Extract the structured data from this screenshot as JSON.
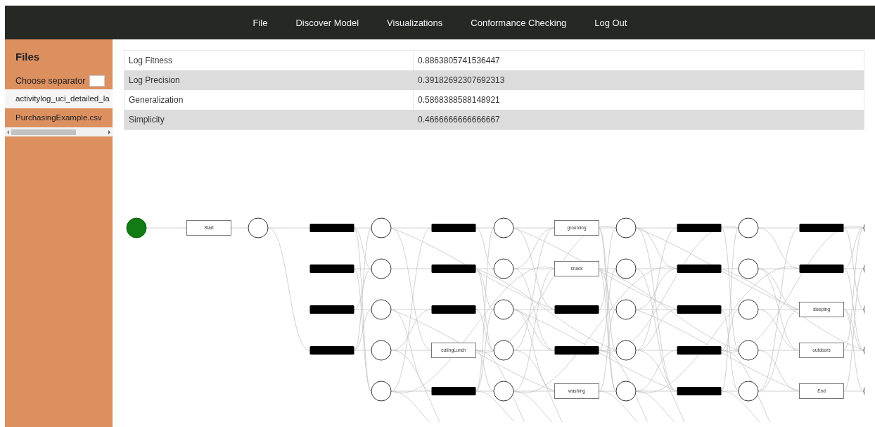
{
  "nav": {
    "items": [
      "File",
      "Discover Model",
      "Visualizations",
      "Conformance Checking",
      "Log Out"
    ]
  },
  "sidebar": {
    "title": "Files",
    "separator_label": "Choose separator",
    "files": [
      {
        "name": "activitylog_uci_detailed_la",
        "selected": true
      },
      {
        "name": "PurchasingExample.csv",
        "selected": false
      }
    ]
  },
  "metrics": [
    {
      "name": "Log Fitness",
      "value": "0.8863805741536447"
    },
    {
      "name": "Log Precision",
      "value": "0.39182692307692313"
    },
    {
      "name": "Generalization",
      "value": "0.5868388588148921"
    },
    {
      "name": "Simplicity",
      "value": "0.4666666666666667"
    }
  ],
  "petri_net": {
    "columns": [
      {
        "nodes": [
          {
            "kind": "source"
          }
        ]
      },
      {
        "nodes": [
          {
            "kind": "transition",
            "label": "Start"
          }
        ]
      },
      {
        "nodes": [
          {
            "kind": "place"
          }
        ]
      },
      {
        "nodes": [
          {
            "kind": "silent"
          },
          {
            "kind": "silent"
          },
          {
            "kind": "silent"
          },
          {
            "kind": "silent"
          }
        ]
      },
      {
        "nodes": [
          {
            "kind": "place"
          },
          {
            "kind": "place"
          },
          {
            "kind": "place"
          },
          {
            "kind": "place"
          },
          {
            "kind": "place"
          }
        ]
      },
      {
        "nodes": [
          {
            "kind": "silent"
          },
          {
            "kind": "silent"
          },
          {
            "kind": "silent"
          },
          {
            "kind": "transition",
            "label": "eatingLunch"
          },
          {
            "kind": "silent"
          }
        ]
      },
      {
        "nodes": [
          {
            "kind": "place"
          },
          {
            "kind": "place"
          },
          {
            "kind": "place"
          },
          {
            "kind": "place"
          },
          {
            "kind": "place"
          }
        ]
      },
      {
        "nodes": [
          {
            "kind": "transition",
            "label": "grooming"
          },
          {
            "kind": "transition",
            "label": "snack"
          },
          {
            "kind": "silent"
          },
          {
            "kind": "silent"
          },
          {
            "kind": "transition",
            "label": "washing"
          }
        ]
      },
      {
        "nodes": [
          {
            "kind": "place"
          },
          {
            "kind": "place"
          },
          {
            "kind": "place"
          },
          {
            "kind": "place"
          },
          {
            "kind": "place"
          }
        ]
      },
      {
        "nodes": [
          {
            "kind": "silent"
          },
          {
            "kind": "silent"
          },
          {
            "kind": "silent"
          },
          {
            "kind": "silent"
          },
          {
            "kind": "silent"
          }
        ]
      },
      {
        "nodes": [
          {
            "kind": "place"
          },
          {
            "kind": "place"
          },
          {
            "kind": "place"
          },
          {
            "kind": "place"
          },
          {
            "kind": "place"
          }
        ]
      },
      {
        "nodes": [
          {
            "kind": "silent"
          },
          {
            "kind": "silent"
          },
          {
            "kind": "transition",
            "label": "sleeping"
          },
          {
            "kind": "transition",
            "label": "outdoors"
          },
          {
            "kind": "transition",
            "label": "End"
          }
        ]
      },
      {
        "nodes": [
          {
            "kind": "place"
          },
          {
            "kind": "place"
          },
          {
            "kind": "place"
          },
          {
            "kind": "place"
          },
          {
            "kind": "place"
          }
        ]
      }
    ]
  }
}
